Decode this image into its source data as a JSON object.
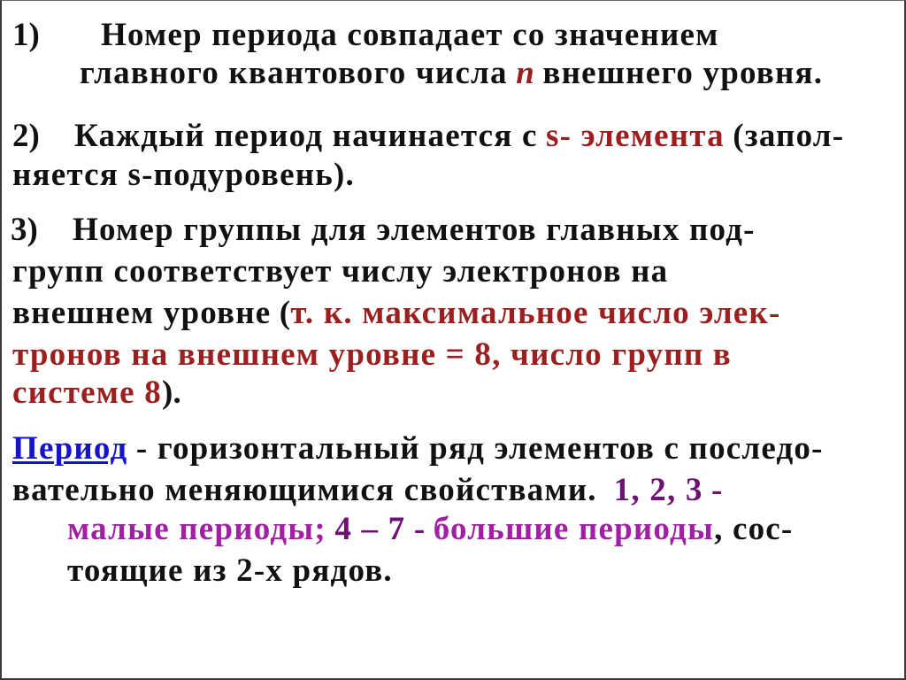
{
  "slide": {
    "language": "ru",
    "background_color": "#ffffff",
    "border_color": "#3a3a3a",
    "colors": {
      "black": "#111111",
      "dark_red": "#9c1f1f",
      "blue_link": "#1414cc",
      "dark_purple": "#6d1173",
      "magenta": "#a01fa5"
    },
    "items": [
      {
        "marker": "1)",
        "lines": [
          {
            "segments": [
              {
                "text": "Номер периода совпадает со значением",
                "color": "black"
              }
            ]
          },
          {
            "segments": [
              {
                "text": "главного квантового числа ",
                "color": "black"
              },
              {
                "text": "n",
                "color": "dark_red",
                "style": "italic"
              },
              {
                "text": " внешнего уровня.",
                "color": "black"
              }
            ]
          }
        ]
      },
      {
        "marker": "2)",
        "lines": [
          {
            "segments": [
              {
                "text": "Каждый период начинается с ",
                "color": "black"
              },
              {
                "text": "s- элемента",
                "color": "dark_red"
              },
              {
                "text": " (запол-",
                "color": "black"
              }
            ]
          },
          {
            "segments": [
              {
                "text": "няется s-подуровень).",
                "color": "black"
              }
            ]
          }
        ]
      },
      {
        "marker": "3)",
        "lines": [
          {
            "segments": [
              {
                "text": "Номер группы для  элементов главных  под-",
                "color": "black"
              }
            ]
          },
          {
            "segments": [
              {
                "text": "групп соответствует числу электронов на",
                "color": "black"
              }
            ]
          },
          {
            "segments": [
              {
                "text": "внешнем уровне (",
                "color": "black"
              },
              {
                "text": "т. к. максимальное число элек-",
                "color": "dark_red"
              }
            ]
          },
          {
            "segments": [
              {
                "text": "тронов на внешнем уровне = 8, число групп в",
                "color": "dark_red"
              }
            ]
          },
          {
            "segments": [
              {
                "text": "системе 8",
                "color": "dark_red"
              },
              {
                "text": ").",
                "color": "black"
              }
            ]
          }
        ]
      },
      {
        "marker": "",
        "lines": [
          {
            "segments": [
              {
                "text": "Период",
                "color": "blue_link",
                "style": "underline-link"
              },
              {
                "text": " - горизонтальный ряд элементов с последо-",
                "color": "black"
              }
            ]
          },
          {
            "segments": [
              {
                "text": "вательно меняющимися свойствами. ",
                "color": "black"
              },
              {
                "text": "1, 2, 3",
                "color": "dark_purple"
              },
              {
                "text": " -",
                "color": "dark_purple"
              }
            ]
          },
          {
            "segments": [
              {
                "text": "малые периоды;",
                "color": "magenta"
              },
              {
                "text": " 4 – 7",
                "color": "dark_purple"
              },
              {
                "text": " - ",
                "color": "dark_purple"
              },
              {
                "text": "большие периоды",
                "color": "magenta"
              },
              {
                "text": ",  сос-",
                "color": "black"
              }
            ]
          },
          {
            "segments": [
              {
                "text": "тоящие из 2-х рядов.",
                "color": "black"
              }
            ]
          }
        ]
      }
    ]
  },
  "text": {
    "m1": "1)",
    "m2": "2)",
    "m3": "3)",
    "l1a": "Номер периода совпадает со значением",
    "l1b_pre": "главного квантового числа",
    "l1b_n": "n",
    "l1b_post": "внешнего уровня.",
    "l2a_pre": "Каждый период начинается с",
    "l2a_red": "s- элемента",
    "l2a_post": "(запол-",
    "l2b": "няется s-подуровень).",
    "l3a": "Номер группы для  элементов главных  под-",
    "l3b": "групп соответствует числу электронов на",
    "l3c_pre": "внешнем уровне",
    "l3c_paren": "(",
    "l3c_red": "т. к. максимальное число элек-",
    "l3d": "тронов на внешнем уровне = 8, число групп в",
    "l3e_red": "системе 8",
    "l3e_post": ").",
    "l4a_link": "Период",
    "l4a_rest": "- горизонтальный ряд элементов с последо-",
    "l4b_pre": "вательно меняющимися свойствами.",
    "l4b_nums": "1, 2, 3",
    "l4b_dash": "-",
    "l4c_mag1": "малые периоды;",
    "l4c_nums": "4 – 7",
    "l4c_dash": "-",
    "l4c_mag2": "большие периоды",
    "l4c_tail": ",   сос-",
    "l4d": "тоящие из 2-х рядов."
  }
}
